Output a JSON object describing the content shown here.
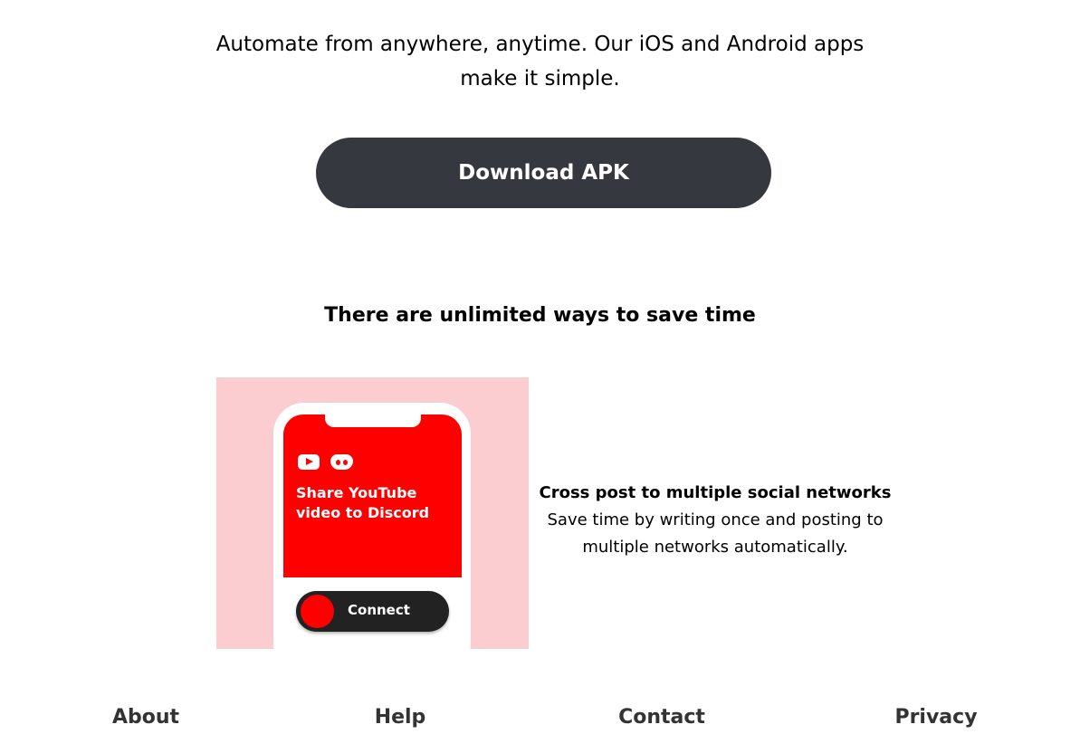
{
  "intro": {
    "line1": "Automate from anywhere, anytime. Our iOS and Android apps",
    "line2": "make it simple."
  },
  "download_label": "Download APK",
  "section_title": "There are unlimited ways to save time",
  "card": {
    "image_title": "Share YouTube video to Discord",
    "image_button": "Connect",
    "title": "Cross post to multiple social networks",
    "description": "Save time by writing once and posting to multiple networks automatically."
  },
  "footer": [
    "About",
    "Help",
    "Contact",
    "Privacy"
  ],
  "colors": {
    "button": "#363840",
    "accent": "#fe0000",
    "card_bg": "#fccdd0"
  }
}
